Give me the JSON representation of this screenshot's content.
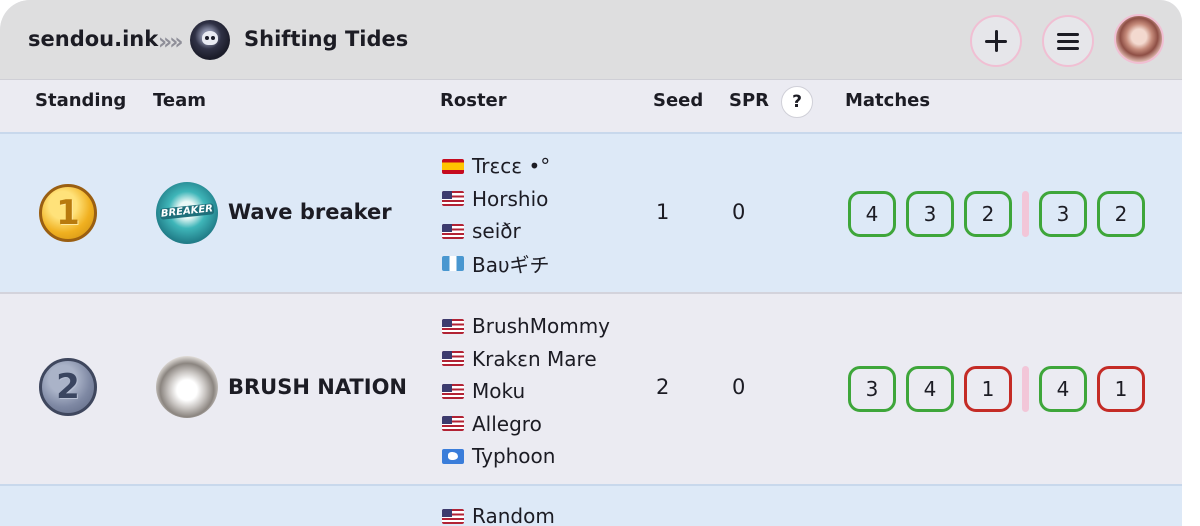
{
  "header": {
    "brand": "sendou.ink",
    "separator": "»",
    "tournament_name": "Shifting Tides"
  },
  "table": {
    "headers": {
      "standing": "Standing",
      "team": "Team",
      "roster": "Roster",
      "seed": "Seed",
      "spr": "SPR",
      "help": "?",
      "matches": "Matches"
    },
    "rows": [
      {
        "standing": "1",
        "medal": "gold",
        "team": "Wave breaker",
        "logo_text": "BREAKER",
        "roster": [
          {
            "name": "Trεcε •°",
            "flag": "es"
          },
          {
            "name": "Horshio",
            "flag": "us"
          },
          {
            "name": "seiðr",
            "flag": "us"
          },
          {
            "name": "Baυギチ",
            "flag": "gt"
          }
        ],
        "seed": "1",
        "spr": "0",
        "matches_a": [
          {
            "score": "4",
            "result": "win"
          },
          {
            "score": "3",
            "result": "win"
          },
          {
            "score": "2",
            "result": "win"
          }
        ],
        "matches_b": [
          {
            "score": "3",
            "result": "win"
          },
          {
            "score": "2",
            "result": "win"
          }
        ]
      },
      {
        "standing": "2",
        "medal": "silver",
        "team": "BRUSH NATION",
        "roster": [
          {
            "name": "BrushMommy",
            "flag": "us"
          },
          {
            "name": "Krakεn Mare",
            "flag": "us"
          },
          {
            "name": "Moku",
            "flag": "us"
          },
          {
            "name": "Allegro",
            "flag": "us"
          },
          {
            "name": "Typhoon",
            "flag": "aq"
          }
        ],
        "seed": "2",
        "spr": "0",
        "matches_a": [
          {
            "score": "3",
            "result": "win"
          },
          {
            "score": "4",
            "result": "win"
          },
          {
            "score": "1",
            "result": "loss"
          }
        ],
        "matches_b": [
          {
            "score": "4",
            "result": "win"
          },
          {
            "score": "1",
            "result": "loss"
          }
        ]
      },
      {
        "roster": [
          {
            "name": "Random",
            "flag": "us"
          }
        ]
      }
    ]
  },
  "colors": {
    "win": "#3ea63a",
    "loss": "#c42b26",
    "accent_pink": "#f0bfd3",
    "row_highlight": "#dde9f7"
  }
}
